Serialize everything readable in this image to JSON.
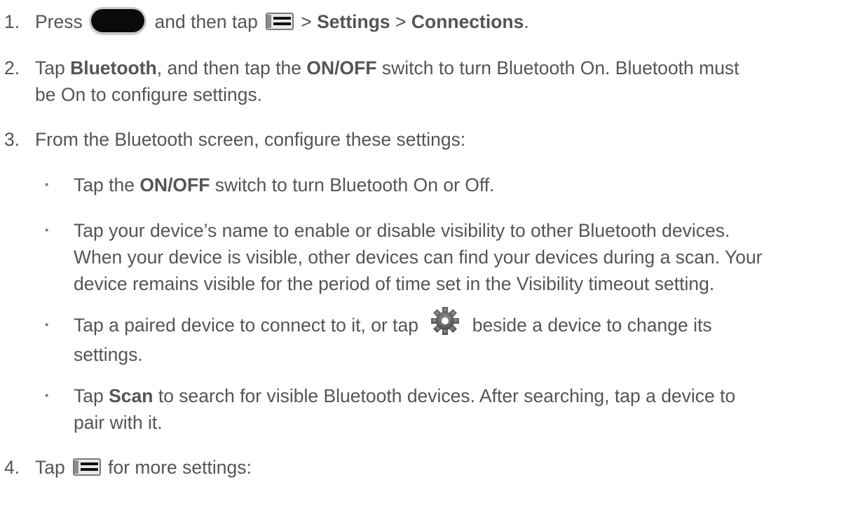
{
  "steps": [
    {
      "number": "1.",
      "text_press": "Press",
      "text_then_tap": "and then tap",
      "sep1": ">",
      "settings": "Settings",
      "sep2": ">",
      "connections": "Connections",
      "end": "."
    },
    {
      "number": "2.",
      "tap": "Tap",
      "bluetooth": "Bluetooth",
      "mid": ", and then tap the",
      "onoff": "ON/OFF",
      "rest_line1": "switch to turn Bluetooth On. Bluetooth must",
      "line2": "be On to configure settings."
    },
    {
      "number": "3.",
      "text": "From the Bluetooth screen, configure these settings:"
    },
    {
      "number": "4.",
      "tap": "Tap",
      "rest": "for more settings:"
    }
  ],
  "bullets": [
    {
      "mark": "▪",
      "tap": "Tap the",
      "onoff": "ON/OFF",
      "rest": "switch to turn Bluetooth On or Off."
    },
    {
      "mark": "▪",
      "line1": "Tap your device’s name to enable or disable visibility to other Bluetooth devices.",
      "line2": "When your device is visible, other devices can find your devices during a scan. Your",
      "line3": "device remains visible for the period of time set in the Visibility timeout setting."
    },
    {
      "mark": "▪",
      "line1a": "Tap a paired device to connect to it, or tap",
      "line1b": "beside a device to change its",
      "line2": "settings."
    },
    {
      "mark": "▪",
      "tap": "Tap",
      "scan": "Scan",
      "rest_line1": "to search for visible Bluetooth devices. After searching, tap a device to",
      "line2": "pair with it."
    }
  ],
  "icons": {
    "home": "home-button-icon",
    "menu": "menu-icon",
    "gear": "gear-icon"
  }
}
